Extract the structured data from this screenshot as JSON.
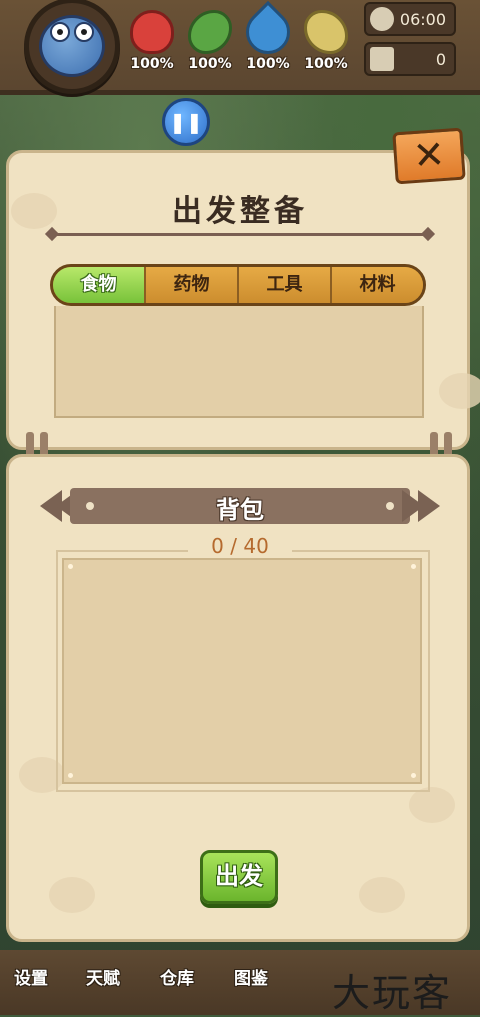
{
  "hud": {
    "stats": [
      {
        "name": "health",
        "value": "100%"
      },
      {
        "name": "hunger",
        "value": "100%"
      },
      {
        "name": "thirst",
        "value": "100%"
      },
      {
        "name": "strength",
        "value": "100%"
      }
    ],
    "time": "06:00",
    "day": "0",
    "pause_icon": "❚❚"
  },
  "panel": {
    "title": "出发整备",
    "close_icon": "✕",
    "tabs": [
      {
        "label": "食物",
        "active": true
      },
      {
        "label": "药物",
        "active": false
      },
      {
        "label": "工具",
        "active": false
      },
      {
        "label": "材料",
        "active": false
      }
    ],
    "bag_title": "背包",
    "bag_count": "0 / 40",
    "go_label": "出发"
  },
  "nav": {
    "items": [
      "设置",
      "天赋",
      "仓库",
      "图鉴"
    ]
  },
  "watermark": "大玩客"
}
